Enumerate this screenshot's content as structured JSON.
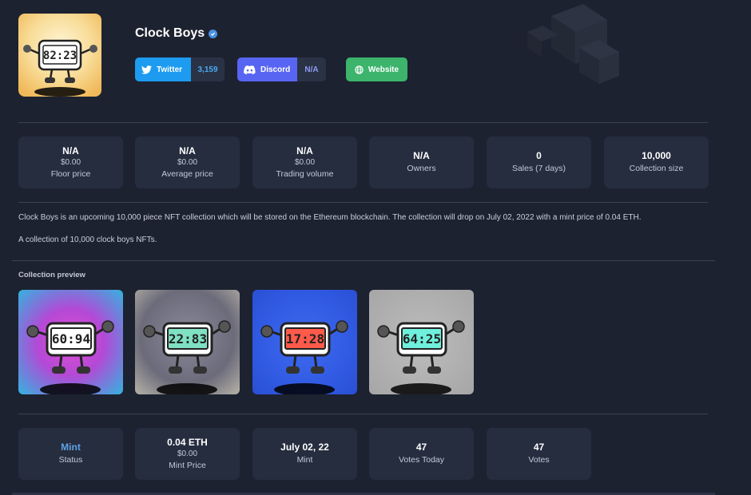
{
  "collection": {
    "name": "Clock Boys",
    "avatar_time": "82:23"
  },
  "socials": {
    "twitter": {
      "label": "Twitter",
      "count": "3,159"
    },
    "discord": {
      "label": "Discord",
      "count": "N/A"
    },
    "website": {
      "label": "Website"
    }
  },
  "stats": [
    {
      "value": "N/A",
      "sub": "$0.00",
      "label": "Floor price"
    },
    {
      "value": "N/A",
      "sub": "$0.00",
      "label": "Average price"
    },
    {
      "value": "N/A",
      "sub": "$0.00",
      "label": "Trading volume"
    },
    {
      "value": "N/A",
      "sub": "",
      "label": "Owners"
    },
    {
      "value": "0",
      "sub": "",
      "label": "Sales (7 days)"
    },
    {
      "value": "10,000",
      "sub": "",
      "label": "Collection size"
    }
  ],
  "description": {
    "line1": "Clock Boys is an upcoming 10,000 piece NFT collection which will be stored on the Ethereum blockchain. The collection will drop on July 02, 2022 with a mint price of 0.04 ETH.",
    "line2": "A collection of 10,000 clock boys NFTs."
  },
  "preview": {
    "label": "Collection preview",
    "items": [
      {
        "time": "60:94",
        "screen_color": "#ffffff",
        "bg": "radial-gradient(circle at 50% 50%, #e14fd0 0%, #b449d6 45%, #33b3df 100%)"
      },
      {
        "time": "22:83",
        "screen_color": "#7fe0c2",
        "bg": "radial-gradient(circle at 50% 45%, #8a8a9c 0%, #6b6b7a 60%, #b7b2a8 100%)"
      },
      {
        "time": "17:28",
        "screen_color": "#ff5a4a",
        "bg": "radial-gradient(circle at 50% 50%, #3e6bf0 0%, #2f58e0 70%, #2a4fd4 100%)"
      },
      {
        "time": "64:25",
        "screen_color": "#6ff0dc",
        "bg": "radial-gradient(circle at 50% 50%, #bdbdbd 0%, #a6a6a6 100%)"
      }
    ]
  },
  "mint": [
    {
      "value": "Mint",
      "sub": "",
      "label": "Status"
    },
    {
      "value": "0.04 ETH",
      "sub": "$0.00",
      "label": "Mint Price"
    },
    {
      "value": "July 02, 22",
      "sub": "",
      "label": "Mint"
    },
    {
      "value": "47",
      "sub": "",
      "label": "Votes Today"
    },
    {
      "value": "47",
      "sub": "",
      "label": "Votes"
    }
  ],
  "colors": {
    "background": "#1d2230",
    "card": "#252d3f",
    "twitter": "#1d9bf0",
    "discord": "#5865f2",
    "website": "#3cb46c",
    "status_mint": "#5fa2e6"
  }
}
